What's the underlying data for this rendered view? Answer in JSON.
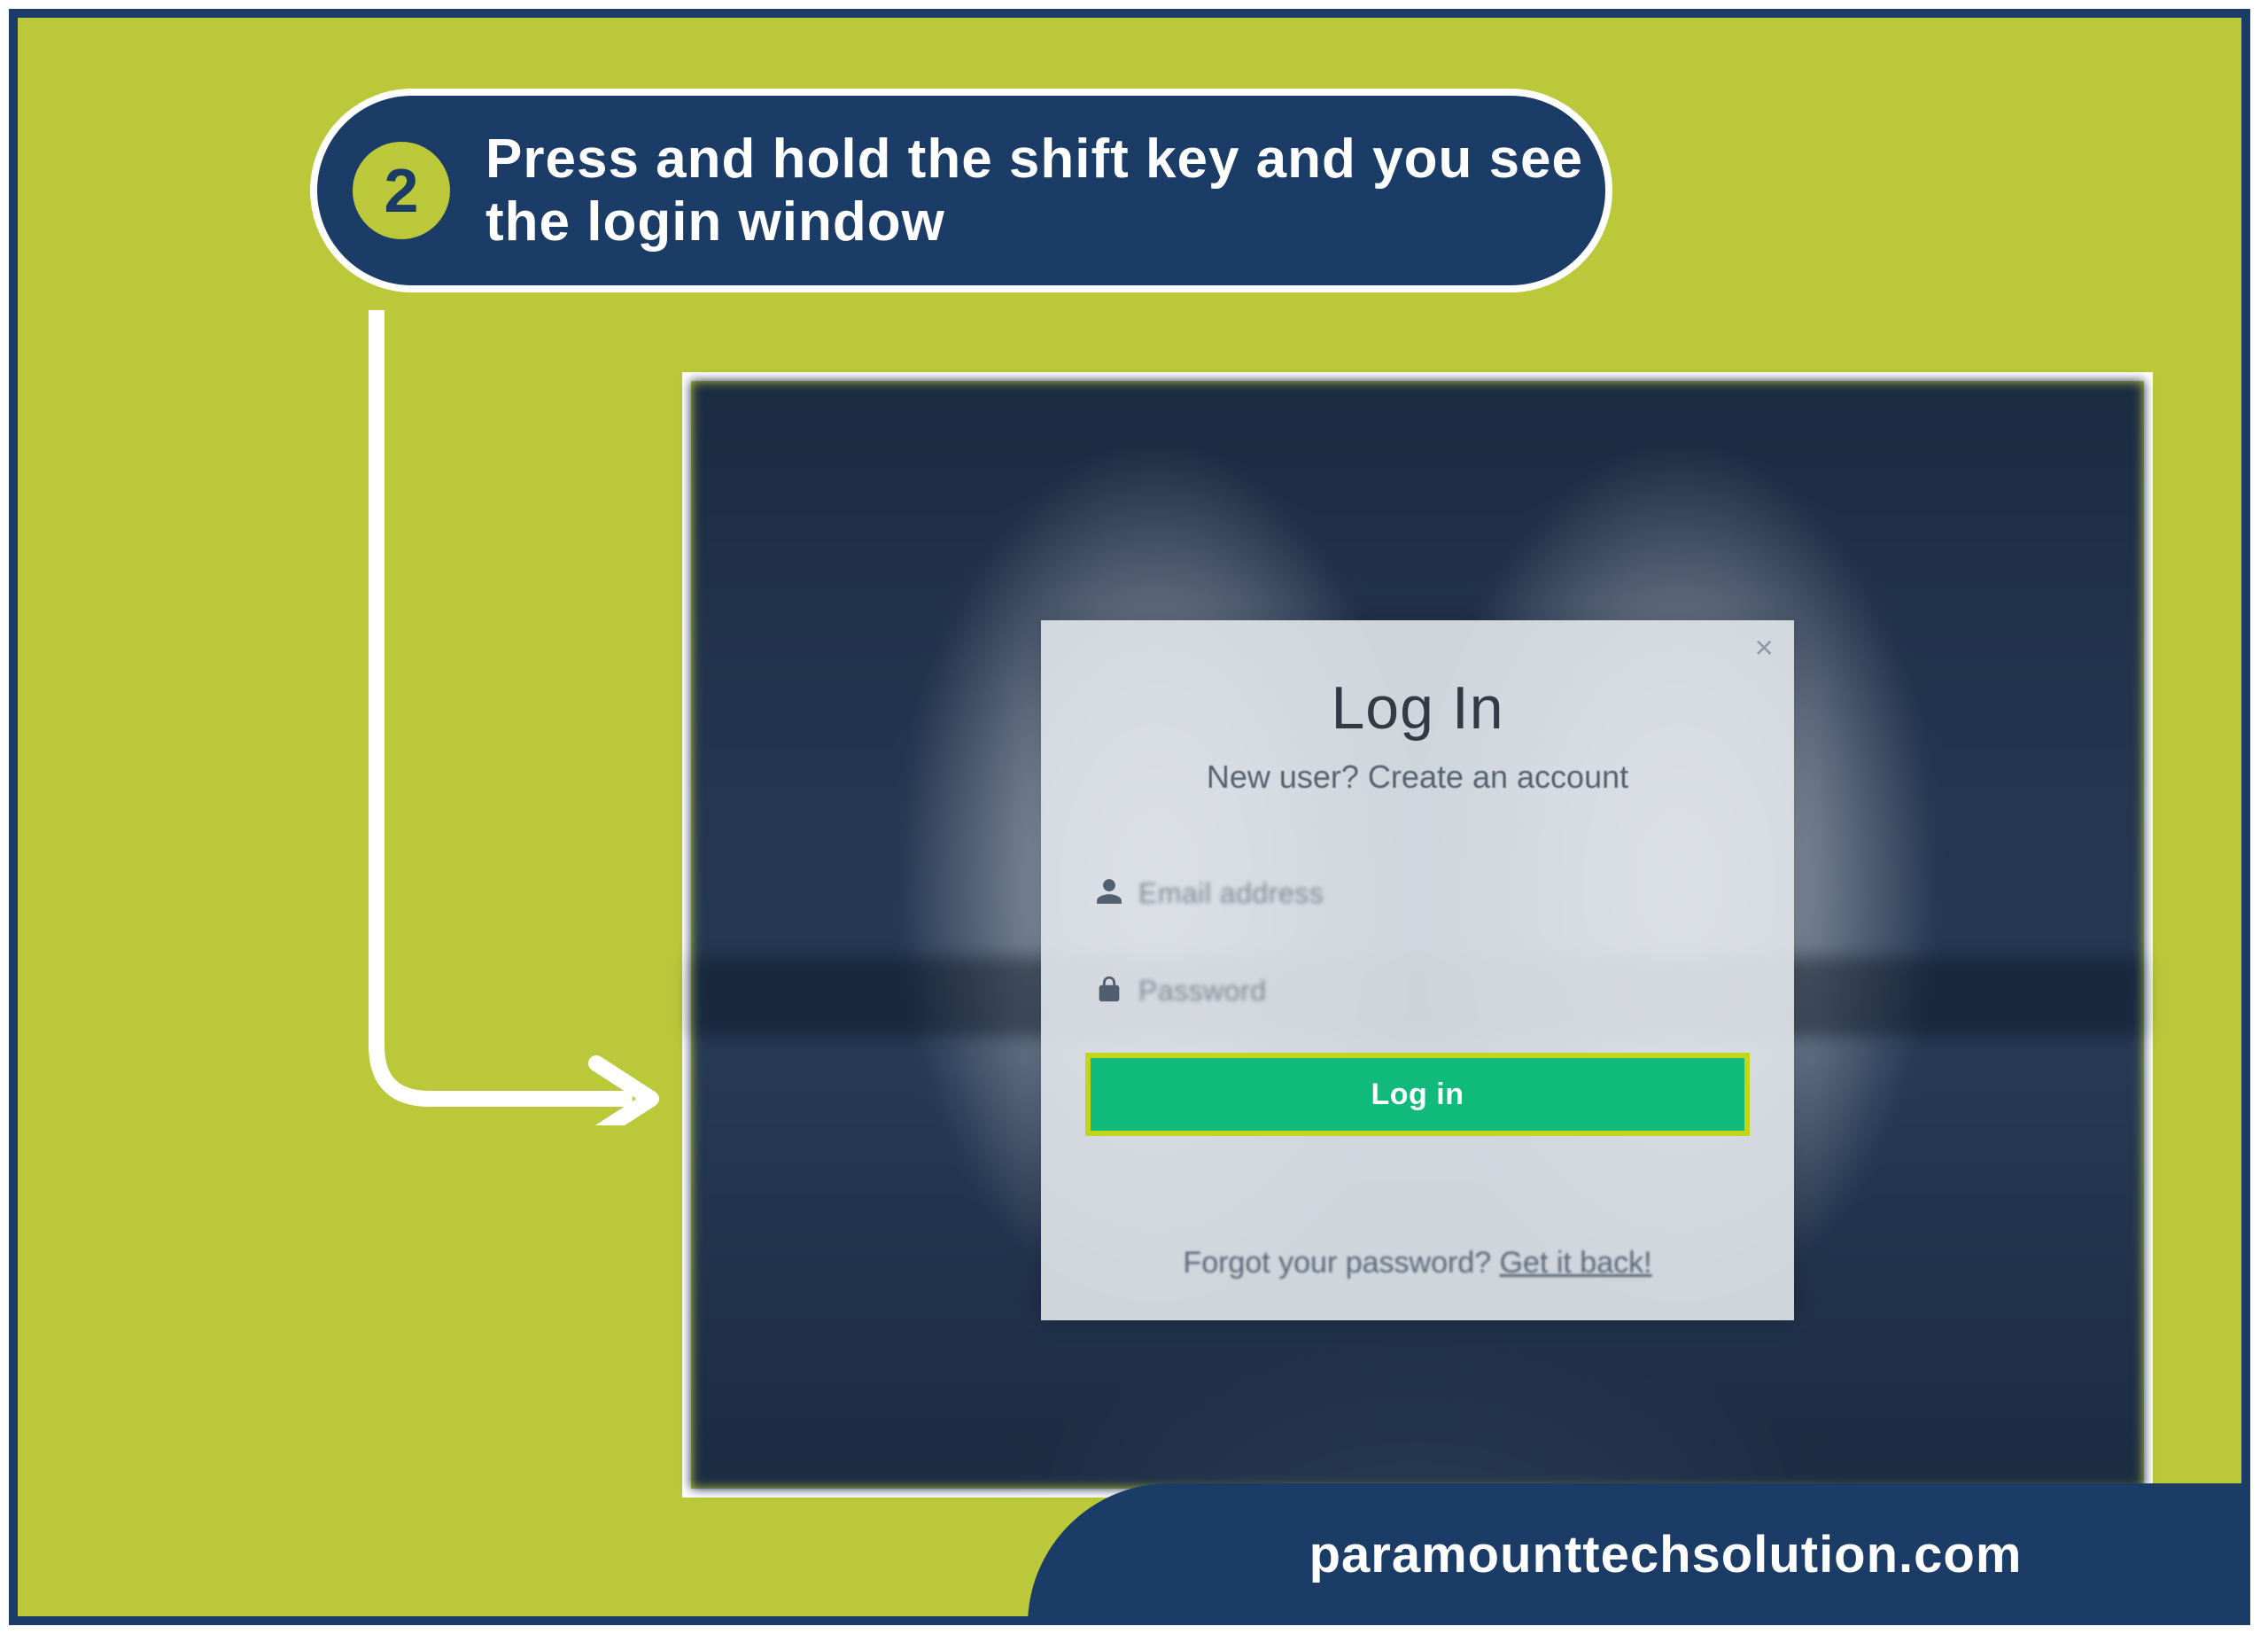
{
  "step": {
    "number": "2",
    "text": "Press and hold the shift key and you see the login window"
  },
  "login": {
    "title": "Log In",
    "subtitle": "New user? Create an account",
    "email_placeholder": "Email address",
    "password_placeholder": "Password",
    "button_label": "Log in",
    "forgot_prefix": "Forgot your password? ",
    "forgot_link": "Get it back!"
  },
  "footer": {
    "site": "paramounttechsolution.com"
  },
  "colors": {
    "bg_olive": "#bac839",
    "navy": "#1b3c67",
    "btn_green": "#0fba7b",
    "btn_border": "#c4d41a"
  }
}
